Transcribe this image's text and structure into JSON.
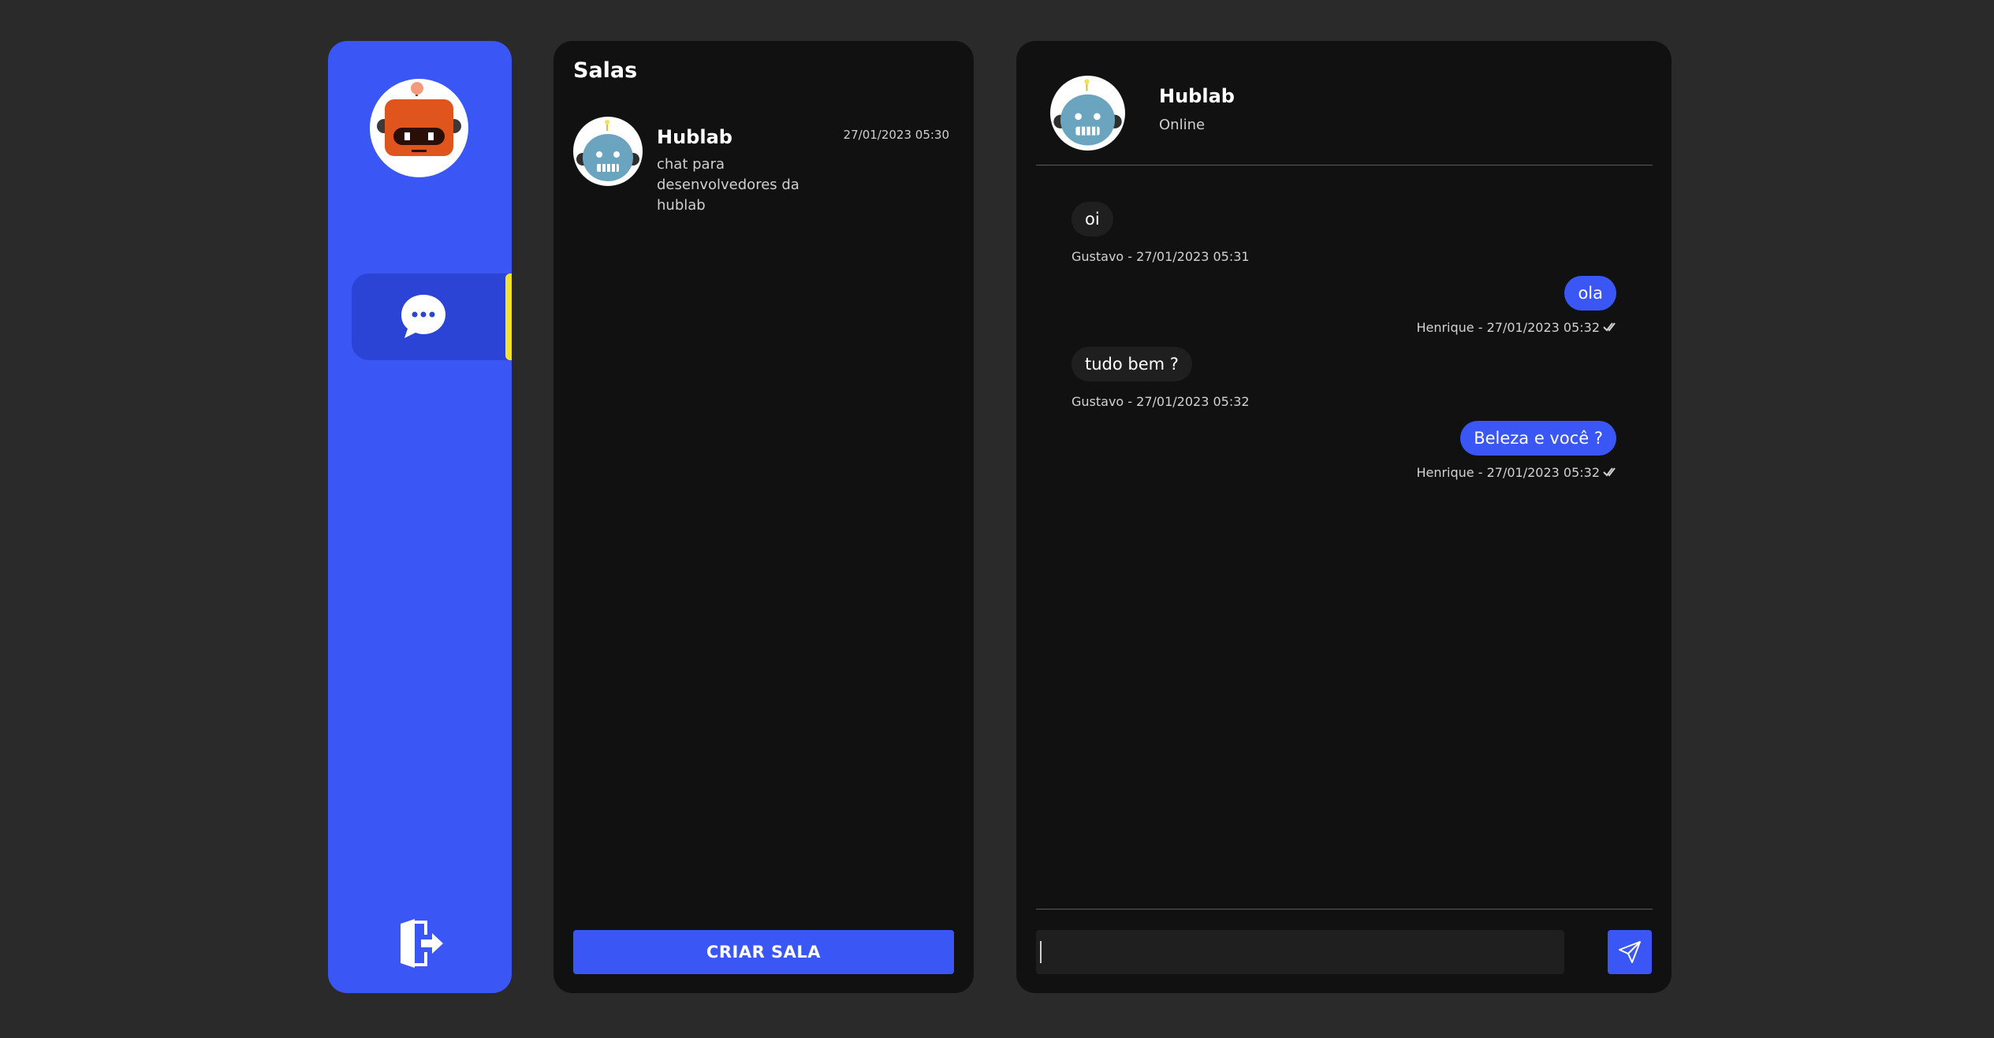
{
  "sidebar": {
    "user_avatar": "orange-robot-avatar",
    "nav": [
      {
        "icon": "chat-bubble-icon",
        "active": true
      }
    ],
    "logout_icon": "logout-door-icon",
    "colors": {
      "background": "#3a57f5",
      "active_item": "#2b44d6",
      "indicator": "#f5e22e"
    }
  },
  "rooms": {
    "title": "Salas",
    "items": [
      {
        "name": "Hublab",
        "description": "chat para desenvolvedores da hublab",
        "time": "27/01/2023 05:30",
        "avatar": "blue-robot-avatar"
      }
    ],
    "create_button": "CRIAR SALA"
  },
  "chat": {
    "title": "Hublab",
    "status": "Online",
    "avatar": "blue-robot-avatar",
    "messages": [
      {
        "text": "oi",
        "meta": "Gustavo - 27/01/2023 05:31",
        "direction": "in"
      },
      {
        "text": "ola",
        "meta": "Henrique - 27/01/2023 05:32",
        "direction": "out",
        "read": true
      },
      {
        "text": "tudo bem ?",
        "meta": "Gustavo - 27/01/2023 05:32",
        "direction": "in"
      },
      {
        "text": "Beleza e você ?",
        "meta": "Henrique - 27/01/2023 05:32",
        "direction": "out",
        "read": true
      }
    ],
    "input": {
      "value": "",
      "placeholder": ""
    },
    "send_icon": "send-paper-plane-icon"
  },
  "theme": {
    "page": "#2a2a2a",
    "panel": "#111111",
    "accent": "#3a57f5",
    "bubble_in": "#1f1f1f"
  }
}
